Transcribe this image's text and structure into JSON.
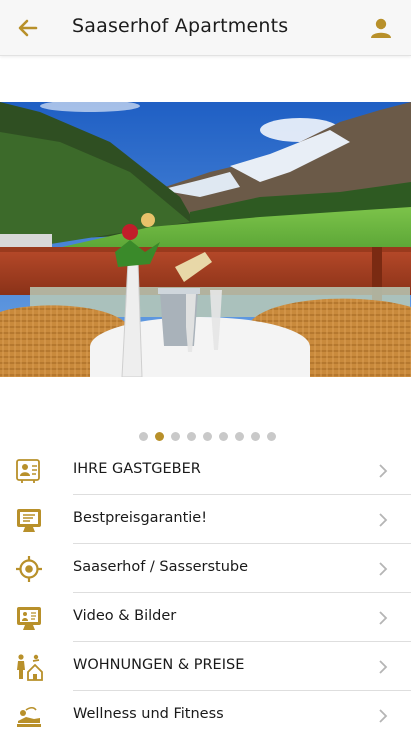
{
  "header": {
    "title": "Saaserhof Apartments",
    "back_icon": "arrow-back-icon",
    "user_icon": "account-icon"
  },
  "colors": {
    "accent": "#b8902a",
    "appbar_bg": "#f7f7f7"
  },
  "carousel": {
    "slide_count": 9,
    "active_index": 1
  },
  "menu": [
    {
      "label": "IHRE GASTGEBER",
      "icon": "hosts-icon"
    },
    {
      "label": "Bestpreisgarantie!",
      "icon": "price-guarantee-icon"
    },
    {
      "label": "Saaserhof / Sasserstube",
      "icon": "location-target-icon"
    },
    {
      "label": "Video & Bilder",
      "icon": "gallery-icon"
    },
    {
      "label": "WOHNUNGEN & PREISE",
      "icon": "family-house-icon"
    },
    {
      "label": "Wellness und Fitness",
      "icon": "wellness-icon"
    }
  ]
}
